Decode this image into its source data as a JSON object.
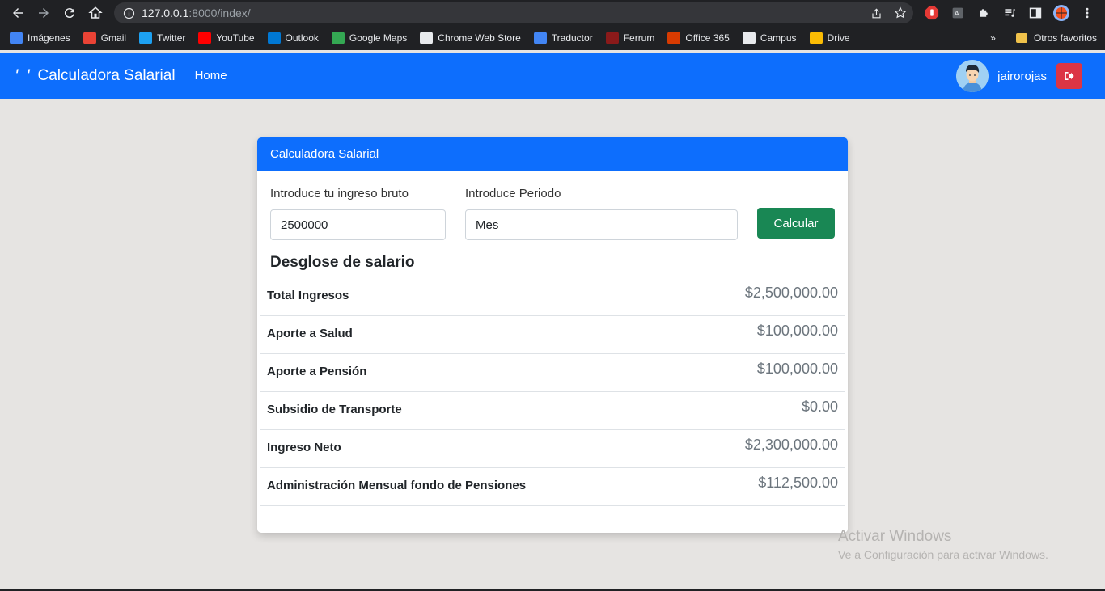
{
  "browser": {
    "url_host": "127.0.0.1",
    "url_rest": ":8000/index/",
    "bookmarks": [
      {
        "label": "Imágenes",
        "color": "#4285f4"
      },
      {
        "label": "Gmail",
        "color": "#ea4335"
      },
      {
        "label": "Twitter",
        "color": "#1da1f2"
      },
      {
        "label": "YouTube",
        "color": "#ff0000"
      },
      {
        "label": "Outlook",
        "color": "#0078d4"
      },
      {
        "label": "Google Maps",
        "color": "#34a853"
      },
      {
        "label": "Chrome Web Store",
        "color": "#e8eaed"
      },
      {
        "label": "Traductor",
        "color": "#4285f4"
      },
      {
        "label": "Ferrum",
        "color": "#8b1a1a"
      },
      {
        "label": "Office 365",
        "color": "#d83b01"
      },
      {
        "label": "Campus",
        "color": "#e8eaed"
      },
      {
        "label": "Drive",
        "color": "#fbbc04"
      }
    ],
    "other_bookmarks": "Otros favoritos",
    "more_chevron": "»"
  },
  "navbar": {
    "brand_mark": "' '",
    "brand": "Calculadora Salarial",
    "home": "Home",
    "username": "jairorojas",
    "color": "#0d6efd"
  },
  "card": {
    "header": "Calculadora Salarial",
    "income_label": "Introduce tu ingreso bruto",
    "income_value": "2500000",
    "period_label": "Introduce Periodo",
    "period_value": "Mes",
    "calc_button": "Calcular",
    "breakdown_title": "Desglose de salario",
    "rows": [
      {
        "label": "Total Ingresos",
        "value": "$2,500,000.00"
      },
      {
        "label": "Aporte a Salud",
        "value": "$100,000.00"
      },
      {
        "label": "Aporte a Pensión",
        "value": "$100,000.00"
      },
      {
        "label": "Subsidio de Transporte",
        "value": "$0.00"
      },
      {
        "label": "Ingreso Neto",
        "value": "$2,300,000.00"
      },
      {
        "label": "Administración Mensual fondo de Pensiones",
        "value": "$112,500.00"
      }
    ]
  },
  "watermark": {
    "title": "Activar Windows",
    "subtitle": "Ve a Configuración para activar Windows."
  }
}
